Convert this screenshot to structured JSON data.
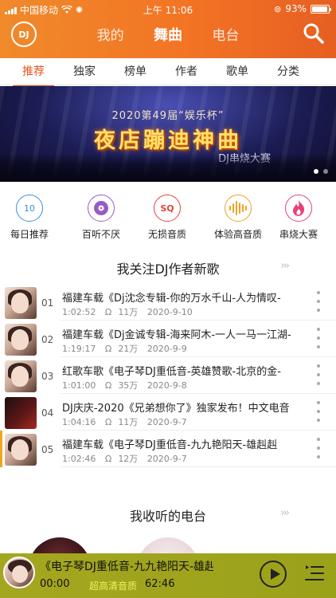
{
  "status_bar": {
    "carrier": "中国移动",
    "time": "上午 11:06",
    "battery": "93%",
    "battery_level": 0.93
  },
  "top_nav": {
    "logo_text": "DJ",
    "tabs": [
      "我的",
      "舞曲",
      "电台"
    ],
    "active_tab": "舞曲"
  },
  "category_tabs": {
    "items": [
      "推荐",
      "独家",
      "榜单",
      "作者",
      "歌单",
      "分类"
    ],
    "active": "推荐"
  },
  "banner": {
    "subtitle": "2020第49届“娱乐杯”",
    "title": "夜店蹦迪神曲",
    "tag": "DJ串烧大赛",
    "page_count": 2,
    "active_page": 1
  },
  "quick_links": [
    {
      "label": "每日推荐",
      "icon": "calendar-10-icon",
      "icon_text": "10",
      "color": "#3a8fe0"
    },
    {
      "label": "百听不厌",
      "icon": "vinyl-icon",
      "icon_text": "",
      "color": "#9b5bc4"
    },
    {
      "label": "无损音质",
      "icon": "sq-icon",
      "icon_text": "SQ",
      "color": "#e0443c"
    },
    {
      "label": "体验高音质",
      "icon": "waveform-icon",
      "icon_text": "",
      "color": "#f1a124"
    },
    {
      "label": "串烧大赛",
      "icon": "flame-icon",
      "icon_text": "",
      "color": "#e8417a"
    }
  ],
  "section_follow": {
    "title": "我关注DJ作者新歌",
    "more_icon": "double-chevron-right-icon"
  },
  "songs": [
    {
      "num": "01",
      "title": "福建车载《Dj沈念专辑-你的万水千山-人为情叹-",
      "duration": "1:02:52",
      "plays": "11万",
      "date": "2020-9-10",
      "playing": false
    },
    {
      "num": "02",
      "title": "福建车载《Dj金诚专辑-海来阿木-一人一马一江湖-",
      "duration": "1:19:17",
      "plays": "21万",
      "date": "2020-9-9",
      "playing": false
    },
    {
      "num": "03",
      "title": "红歌车歌《电子琴DJ重低音-英雄赞歌-北京的金-",
      "duration": "1:01:00",
      "plays": "35万",
      "date": "2020-9-8",
      "playing": false
    },
    {
      "num": "04",
      "title": "DJ庆庆-2020《兄弟想你了》独家发布！中文电音",
      "duration": "1:04:16",
      "plays": "11万",
      "date": "2020-9-7",
      "playing": false
    },
    {
      "num": "05",
      "title": "福建车载《电子琴DJ重低音-九九艳阳天-雄赳赳",
      "duration": "1:02:46",
      "plays": "12万",
      "date": "2020-9-7",
      "playing": true
    }
  ],
  "section_radio": {
    "title": "我收听的电台",
    "more_icon": "double-chevron-right-icon"
  },
  "player": {
    "title": "《电子琴DJ重低音-九九艳阳天-雄赳",
    "current_time": "00:00",
    "quality": "超高清音质",
    "duration": "62:46"
  }
}
